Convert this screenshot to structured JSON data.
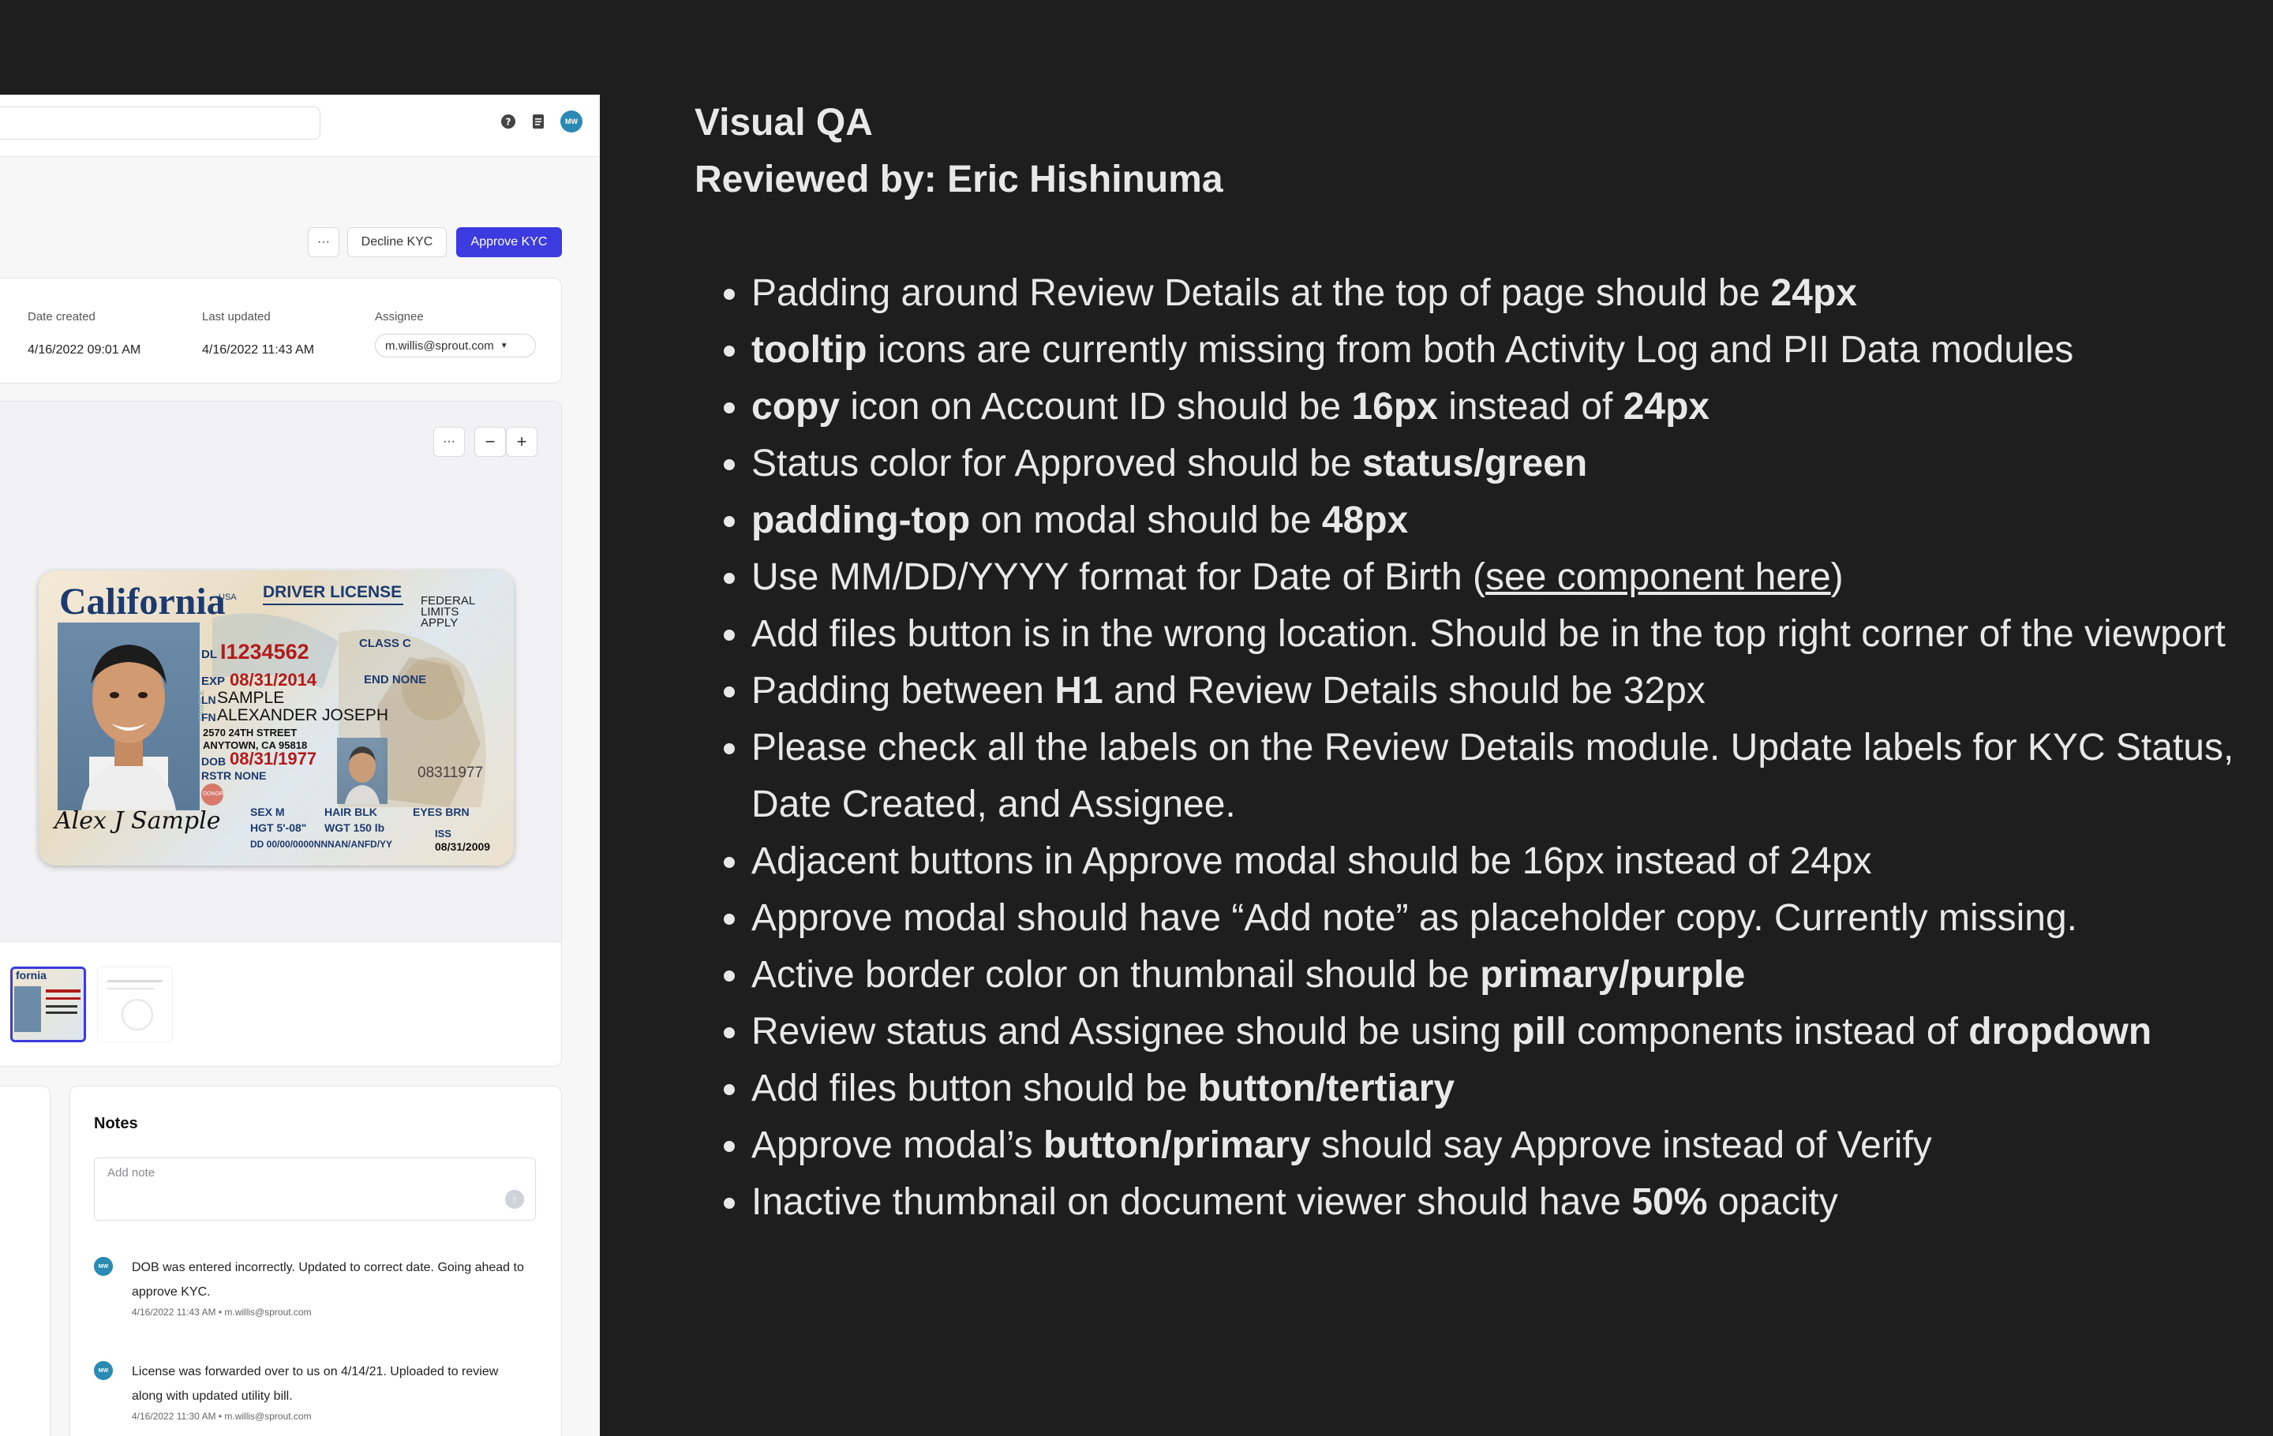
{
  "topbar": {
    "avatar_initials": "MW"
  },
  "actions": {
    "more": "···",
    "decline": "Decline KYC",
    "approve": "Approve KYC"
  },
  "details": {
    "date_created_label": "Date created",
    "date_created_value": "4/16/2022 09:01 AM",
    "last_updated_label": "Last updated",
    "last_updated_value": "4/16/2022 11:43 AM",
    "assignee_label": "Assignee",
    "assignee_value": "m.willis@sprout.com"
  },
  "viewer": {
    "more": "···",
    "zoom_out": "−",
    "zoom_in": "+",
    "license": {
      "state": "California",
      "usa": "USA",
      "title": "DRIVER LICENSE",
      "federal": [
        "FEDERAL",
        "LIMITS",
        "APPLY"
      ],
      "dl_label": "DL",
      "dl": "I1234562",
      "class": "CLASS C",
      "exp_label": "EXP",
      "exp": "08/31/2014",
      "end": "END NONE",
      "ln_label": "LN",
      "ln": "SAMPLE",
      "fn_label": "FN",
      "fn": "ALEXANDER JOSEPH",
      "address1": "2570 24TH STREET",
      "address2": "ANYTOWN, CA 95818",
      "dob_label": "DOB",
      "dob": "08/31/1977",
      "rstr": "RSTR NONE",
      "number": "08311977",
      "sex": "SEX  M",
      "hair": "HAIR  BLK",
      "eyes": "EYES BRN",
      "hgt": "HGT  5'-08\"",
      "wgt": "WGT  150 lb",
      "iss_label": "ISS",
      "iss": "08/31/2009",
      "dd": "DD 00/00/0000NNNAN/ANFD/YY",
      "signature": "Alex J Sample",
      "sample_mark": "SAMPLE",
      "donor": "DONOR"
    },
    "thumb_label": "fornia"
  },
  "notes": {
    "title": "Notes",
    "placeholder": "Add note",
    "items": [
      {
        "initials": "MW",
        "text": "DOB was entered incorrectly. Updated to correct date. Going ahead to approve KYC.",
        "meta": "4/16/2022 11:43 AM • m.willis@sprout.com"
      },
      {
        "initials": "MW",
        "text": "License was forwarded over to us on 4/14/21. Uploaded to review along with updated utility bill.",
        "meta": "4/16/2022 11:30 AM • m.willis@sprout.com"
      }
    ]
  },
  "qa": {
    "title": "Visual QA",
    "reviewer": "Reviewed by: Eric Hishinuma",
    "items": [
      [
        "Padding around Review Details at the top of page should be ",
        {
          "b": "24px"
        }
      ],
      [
        {
          "b": "tooltip"
        },
        " icons are currently missing from both Activity Log and PII Data modules"
      ],
      [
        {
          "b": "copy"
        },
        " icon on Account ID should be ",
        {
          "b": "16px"
        },
        " instead of ",
        {
          "b": "24px"
        }
      ],
      [
        "Status color for Approved should be ",
        {
          "b": "status/green"
        }
      ],
      [
        {
          "b": "padding-top"
        },
        " on modal should be ",
        {
          "b": "48px"
        }
      ],
      [
        "Use MM/DD/YYYY format for Date of Birth (",
        {
          "u": "see component here"
        },
        ")"
      ],
      [
        "Add files button is in the wrong location. Should be in the top right corner of the viewport"
      ],
      [
        "Padding between ",
        {
          "b": "H1"
        },
        " and Review Details should be 32px"
      ],
      [
        "Please check all the labels on the Review Details module. Update labels for KYC Status, Date Created, and Assignee."
      ],
      [
        "Adjacent buttons in Approve modal should be 16px instead of 24px"
      ],
      [
        "Approve modal should have “Add note” as placeholder copy. Currently missing."
      ],
      [
        "Active border color on thumbnail should be ",
        {
          "b": "primary/purple"
        }
      ],
      [
        "Review status and Assignee should be using ",
        {
          "b": "pill"
        },
        " components instead of ",
        {
          "b": "dropdown"
        }
      ],
      [
        "Add files button should be ",
        {
          "b": "button/tertiary"
        }
      ],
      [
        "Approve modal’s ",
        {
          "b": "button/primary"
        },
        " should say Approve instead of Verify"
      ],
      [
        "Inactive thumbnail on document viewer should have ",
        {
          "b": "50%"
        },
        " opacity"
      ]
    ]
  }
}
